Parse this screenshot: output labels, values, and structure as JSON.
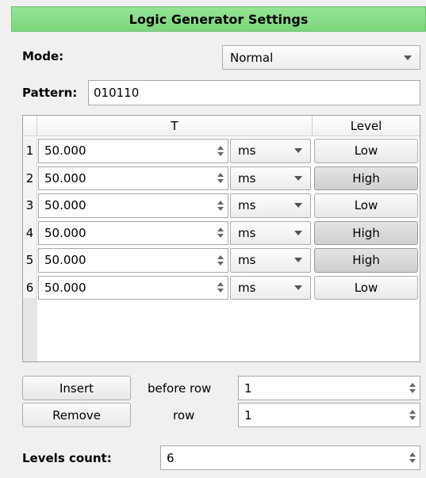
{
  "title": "Logic Generator Settings",
  "mode": {
    "label": "Mode:",
    "value": "Normal"
  },
  "pattern": {
    "label": "Pattern:",
    "value": "010110"
  },
  "table": {
    "headers": {
      "t": "T",
      "level": "Level"
    },
    "rows": [
      {
        "num": "1",
        "value": "50.000",
        "unit": "ms",
        "level": "Low",
        "high": false
      },
      {
        "num": "2",
        "value": "50.000",
        "unit": "ms",
        "level": "High",
        "high": true
      },
      {
        "num": "3",
        "value": "50.000",
        "unit": "ms",
        "level": "Low",
        "high": false
      },
      {
        "num": "4",
        "value": "50.000",
        "unit": "ms",
        "level": "High",
        "high": true
      },
      {
        "num": "5",
        "value": "50.000",
        "unit": "ms",
        "level": "High",
        "high": true
      },
      {
        "num": "6",
        "value": "50.000",
        "unit": "ms",
        "level": "Low",
        "high": false
      }
    ]
  },
  "insert": {
    "button": "Insert",
    "label": "before row",
    "value": "1"
  },
  "remove": {
    "button": "Remove",
    "label": "row",
    "value": "1"
  },
  "levels": {
    "label": "Levels count:",
    "value": "6"
  }
}
